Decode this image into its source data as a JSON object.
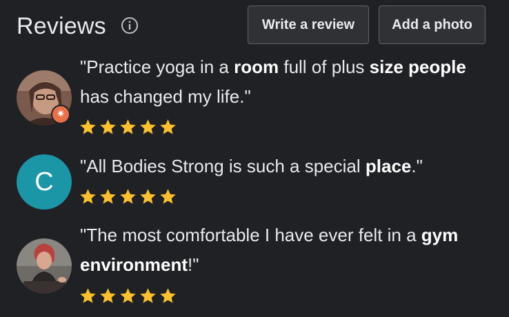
{
  "header": {
    "title": "Reviews",
    "write_review_label": "Write a review",
    "add_photo_label": "Add a photo",
    "info_icon": "info-icon"
  },
  "reviews": [
    {
      "avatar": "photo",
      "badge": "local-guide-star-icon",
      "quote_parts": [
        {
          "text": "\"Practice yoga in a ",
          "bold": false
        },
        {
          "text": "room",
          "bold": true
        },
        {
          "text": " full of plus ",
          "bold": false
        },
        {
          "text": "size people",
          "bold": true
        },
        {
          "text": " has changed my life.\"",
          "bold": false
        }
      ],
      "rating": 5
    },
    {
      "avatar": "letter",
      "avatar_letter": "C",
      "quote_parts": [
        {
          "text": "\"All Bodies Strong is such a special ",
          "bold": false
        },
        {
          "text": "place",
          "bold": true
        },
        {
          "text": ".\"",
          "bold": false
        }
      ],
      "rating": 5
    },
    {
      "avatar": "photo",
      "quote_parts": [
        {
          "text": "\"The most comfortable I have ever felt in a ",
          "bold": false
        },
        {
          "text": "gym environment",
          "bold": true
        },
        {
          "text": "!\"",
          "bold": false
        }
      ],
      "rating": 5
    }
  ],
  "colors": {
    "background": "#202124",
    "star": "#fbc02d",
    "avatar_teal": "#1a96a6",
    "badge_orange": "#e8714a"
  }
}
